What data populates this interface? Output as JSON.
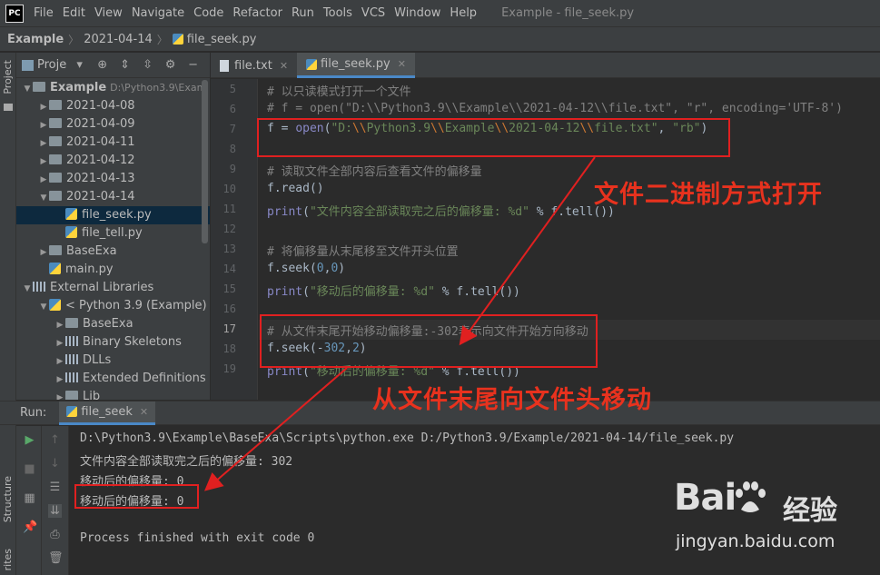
{
  "app": {
    "logo_text": "PC",
    "menu": [
      "File",
      "Edit",
      "View",
      "Navigate",
      "Code",
      "Refactor",
      "Run",
      "Tools",
      "VCS",
      "Window",
      "Help"
    ],
    "window_title": "Example - file_seek.py"
  },
  "breadcrumb": {
    "project": "Example",
    "folder": "2021-04-14",
    "file": "file_seek.py"
  },
  "sidebar": {
    "tabs": {
      "project": "Project",
      "structure": "Structure",
      "favorites": "rites"
    },
    "project_title": "Proje",
    "tree": [
      {
        "label": "Example",
        "extra": "D:\\Python3.9\\Exam",
        "indent": 0,
        "arrow": "down",
        "icon": "folder",
        "bold": true
      },
      {
        "label": "2021-04-08",
        "indent": 1,
        "arrow": "right",
        "icon": "folder"
      },
      {
        "label": "2021-04-09",
        "indent": 1,
        "arrow": "right",
        "icon": "folder"
      },
      {
        "label": "2021-04-11",
        "indent": 1,
        "arrow": "right",
        "icon": "folder"
      },
      {
        "label": "2021-04-12",
        "indent": 1,
        "arrow": "right",
        "icon": "folder"
      },
      {
        "label": "2021-04-13",
        "indent": 1,
        "arrow": "right",
        "icon": "folder"
      },
      {
        "label": "2021-04-14",
        "indent": 1,
        "arrow": "down",
        "icon": "folder"
      },
      {
        "label": "file_seek.py",
        "indent": 2,
        "arrow": "",
        "icon": "py",
        "selected": true
      },
      {
        "label": "file_tell.py",
        "indent": 2,
        "arrow": "",
        "icon": "py"
      },
      {
        "label": "BaseExa",
        "indent": 1,
        "arrow": "right",
        "icon": "folder"
      },
      {
        "label": "main.py",
        "indent": 1,
        "arrow": "",
        "icon": "py"
      },
      {
        "label": "External Libraries",
        "indent": 0,
        "arrow": "down",
        "icon": "lib"
      },
      {
        "label": "< Python 3.9 (Example) >",
        "indent": 1,
        "arrow": "down",
        "icon": "py"
      },
      {
        "label": "BaseExa",
        "indent": 2,
        "arrow": "right",
        "icon": "folder"
      },
      {
        "label": "Binary Skeletons",
        "indent": 2,
        "arrow": "right",
        "icon": "lib"
      },
      {
        "label": "DLLs",
        "indent": 2,
        "arrow": "right",
        "icon": "lib"
      },
      {
        "label": "Extended Definitions",
        "indent": 2,
        "arrow": "right",
        "icon": "lib"
      },
      {
        "label": "Lib",
        "indent": 2,
        "arrow": "right",
        "icon": "folder"
      }
    ]
  },
  "editor": {
    "tabs": [
      {
        "label": "file.txt",
        "icon": "txt",
        "active": false
      },
      {
        "label": "file_seek.py",
        "icon": "py",
        "active": true
      }
    ],
    "current_line": 17,
    "lines": [
      {
        "n": 5,
        "parts": [
          {
            "t": "# 以只读模式打开一个文件",
            "c": "c-comment"
          }
        ]
      },
      {
        "n": 6,
        "parts": [
          {
            "t": "# f = open(\"D:\\\\Python3.9\\\\Example\\\\2021-04-12\\\\file.txt\", \"r\", encoding='UTF-8')",
            "c": "c-comment"
          }
        ]
      },
      {
        "n": 7,
        "parts": [
          {
            "t": "f = ",
            "c": ""
          },
          {
            "t": "open",
            "c": "c-builtin"
          },
          {
            "t": "(",
            "c": ""
          },
          {
            "t": "\"D:",
            "c": "c-str"
          },
          {
            "t": "\\\\",
            "c": "c-esc"
          },
          {
            "t": "Python3.9",
            "c": "c-str"
          },
          {
            "t": "\\\\",
            "c": "c-esc"
          },
          {
            "t": "Example",
            "c": "c-str"
          },
          {
            "t": "\\\\",
            "c": "c-esc"
          },
          {
            "t": "2021-04-12",
            "c": "c-str"
          },
          {
            "t": "\\\\",
            "c": "c-esc"
          },
          {
            "t": "file.txt\"",
            "c": "c-str"
          },
          {
            "t": ", ",
            "c": ""
          },
          {
            "t": "\"rb\"",
            "c": "c-str"
          },
          {
            "t": ")",
            "c": ""
          }
        ]
      },
      {
        "n": 8,
        "parts": []
      },
      {
        "n": 9,
        "parts": [
          {
            "t": "# 读取文件全部内容后查看文件的偏移量",
            "c": "c-comment"
          }
        ]
      },
      {
        "n": 10,
        "parts": [
          {
            "t": "f.read()",
            "c": ""
          }
        ]
      },
      {
        "n": 11,
        "parts": [
          {
            "t": "print",
            "c": "c-builtin"
          },
          {
            "t": "(",
            "c": ""
          },
          {
            "t": "\"文件内容全部读取完之后的偏移量: %d\"",
            "c": "c-str"
          },
          {
            "t": " % f.tell())",
            "c": ""
          }
        ]
      },
      {
        "n": 12,
        "parts": []
      },
      {
        "n": 13,
        "parts": [
          {
            "t": "# 将偏移量从末尾移至文件开头位置",
            "c": "c-comment"
          }
        ]
      },
      {
        "n": 14,
        "parts": [
          {
            "t": "f.seek(",
            "c": ""
          },
          {
            "t": "0",
            "c": "c-num"
          },
          {
            "t": ",",
            "c": ""
          },
          {
            "t": "0",
            "c": "c-num"
          },
          {
            "t": ")",
            "c": ""
          }
        ]
      },
      {
        "n": 15,
        "parts": [
          {
            "t": "print",
            "c": "c-builtin"
          },
          {
            "t": "(",
            "c": ""
          },
          {
            "t": "\"移动后的偏移量: %d\"",
            "c": "c-str"
          },
          {
            "t": " % f.tell())",
            "c": ""
          }
        ]
      },
      {
        "n": 16,
        "parts": []
      },
      {
        "n": 17,
        "parts": [
          {
            "t": "# 从文件末尾开始移动偏移量:-302表示向文件开始方向移动",
            "c": "c-comment"
          }
        ]
      },
      {
        "n": 18,
        "parts": [
          {
            "t": "f.seek(-",
            "c": ""
          },
          {
            "t": "302",
            "c": "c-num"
          },
          {
            "t": ",",
            "c": ""
          },
          {
            "t": "2",
            "c": "c-num"
          },
          {
            "t": ")",
            "c": ""
          }
        ]
      },
      {
        "n": 19,
        "parts": [
          {
            "t": "print",
            "c": "c-builtin"
          },
          {
            "t": "(",
            "c": ""
          },
          {
            "t": "\"移动后的偏移量: %d\"",
            "c": "c-str"
          },
          {
            "t": " % f.tell())",
            "c": ""
          }
        ]
      }
    ]
  },
  "annotations": {
    "binary_open": "文件二进制方式打开",
    "seek_from_end": "从文件末尾向文件头移动"
  },
  "run": {
    "label": "Run:",
    "tab": "file_seek",
    "console": [
      "D:\\Python3.9\\Example\\BaseExa\\Scripts\\python.exe D:/Python3.9/Example/2021-04-14/file_seek.py",
      "文件内容全部读取完之后的偏移量: 302",
      "移动后的偏移量: 0",
      "移动后的偏移量: 0",
      "",
      "Process finished with exit code 0"
    ]
  },
  "watermark": {
    "brand": "Bai",
    "brand_cn": "经验",
    "url": "jingyan.baidu.com"
  },
  "colors": {
    "annotation_red": "#e02020",
    "accent_blue": "#4a88c7"
  }
}
